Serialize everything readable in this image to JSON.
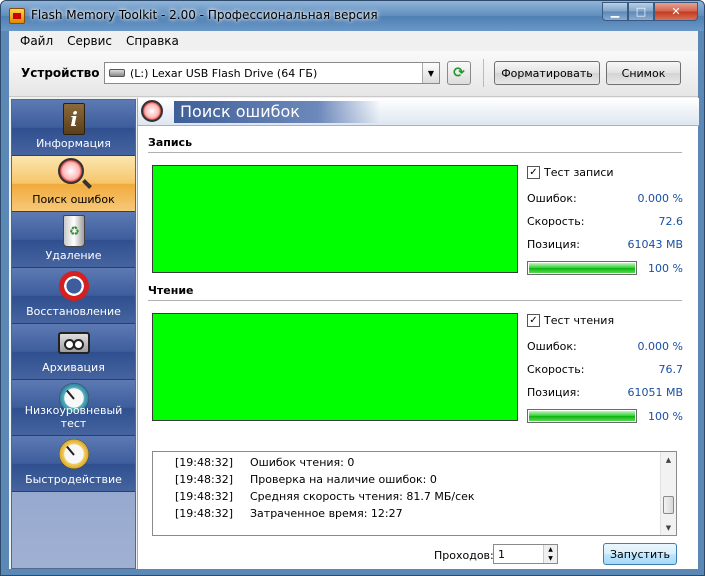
{
  "window": {
    "title": "Flash Memory Toolkit - 2.00 - Профессиональная версия",
    "min": "▁",
    "max": "□",
    "close": "✕"
  },
  "menu": [
    "Файл",
    "Сервис",
    "Справка"
  ],
  "toolbar": {
    "device_label": "Устройство",
    "device_value": "(L:) Lexar   USB Flash Drive (64 ГБ)",
    "refresh": "⟳",
    "format_label": "Форматировать",
    "snapshot_label": "Снимок"
  },
  "sidebar": {
    "items": [
      {
        "label": "Информация",
        "icon": "info-icon",
        "glyph": "i"
      },
      {
        "label": "Поиск ошибок",
        "icon": "magnifier-icon",
        "active": true
      },
      {
        "label": "Удаление",
        "icon": "recycle-bin-icon"
      },
      {
        "label": "Восстановление",
        "icon": "lifebuoy-icon"
      },
      {
        "label": "Архивация",
        "icon": "tape-icon"
      },
      {
        "label": "Низкоуровневый тест",
        "icon": "stopwatch-icon"
      },
      {
        "label": "Быстродействие",
        "icon": "gauge-icon"
      }
    ]
  },
  "main": {
    "title": "Поиск ошибок",
    "write": {
      "section": "Запись",
      "test_label": "Тест записи",
      "checked": "✓",
      "errors_label": "Ошибок:",
      "errors_value": "0.000 %",
      "speed_label": "Скорость:",
      "speed_value": "72.6",
      "position_label": "Позиция:",
      "position_value": "61043 MB",
      "progress_pct": "100 %",
      "progress": 100
    },
    "read": {
      "section": "Чтение",
      "test_label": "Тест чтения",
      "checked": "✓",
      "errors_label": "Ошибок:",
      "errors_value": "0.000 %",
      "speed_label": "Скорость:",
      "speed_value": "76.7",
      "position_label": "Позиция:",
      "position_value": "61051 MB",
      "progress_pct": "100 %",
      "progress": 100
    },
    "log": [
      {
        "time": "[19:48:32]",
        "msg": "Ошибок чтения: 0"
      },
      {
        "time": "[19:48:32]",
        "msg": "Проверка на наличие ошибок: 0"
      },
      {
        "time": "[19:48:32]",
        "msg": "Средняя скорость чтения: 81.7 МБ/сек"
      },
      {
        "time": "[19:48:32]",
        "msg": "Затраченное время: 12:27"
      }
    ],
    "passes_label": "Проходов:",
    "passes_value": "1",
    "run_label": "Запустить"
  },
  "colors": {
    "accent": "#00ff00",
    "value_text": "#1a4fa3",
    "nav_active": "#f6c56a",
    "nav_bg": "#3d5d9c"
  }
}
